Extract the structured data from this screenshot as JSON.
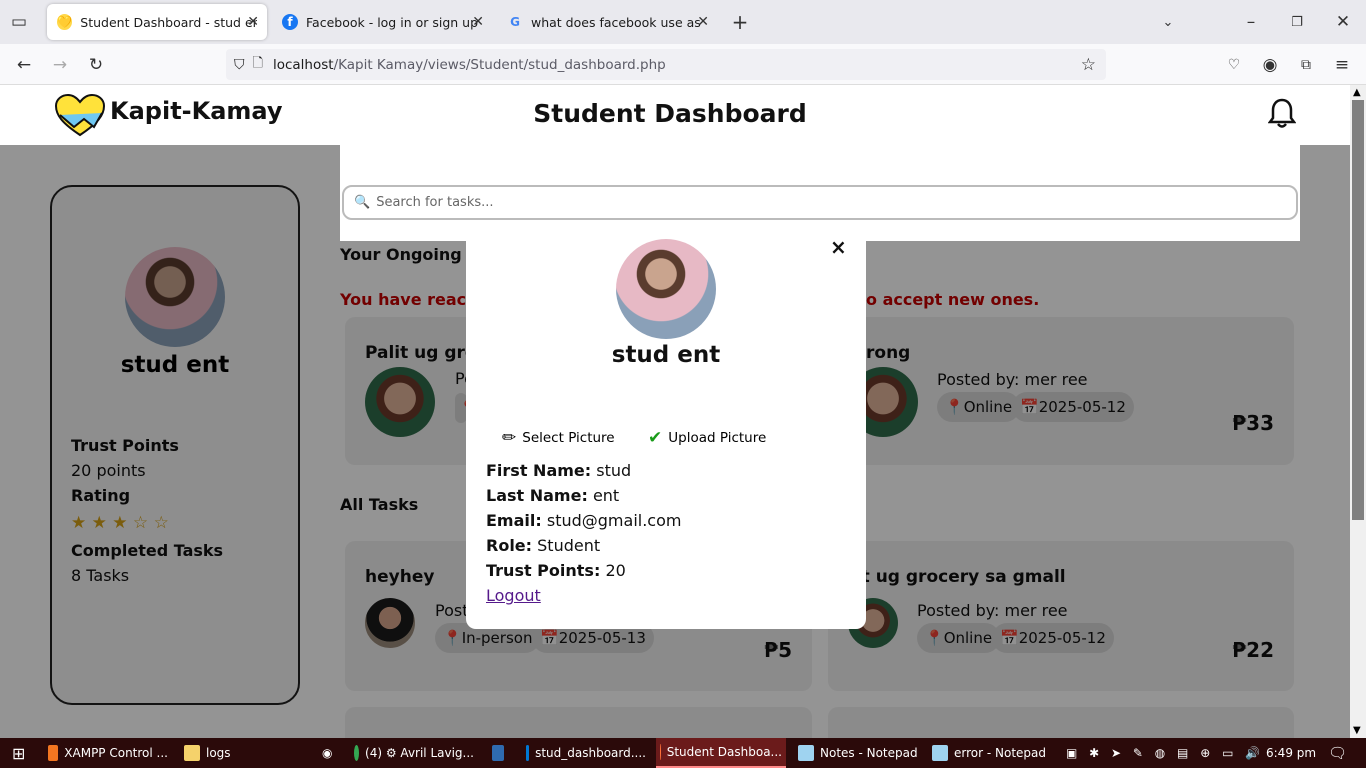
{
  "browser": {
    "tabs": [
      {
        "title": "Student Dashboard - stud ent",
        "active": true
      },
      {
        "title": "Facebook - log in or sign up",
        "active": false
      },
      {
        "title": "what does facebook use as a fo",
        "active": false
      }
    ],
    "url_host": "localhost",
    "url_path": "/Kapit Kamay/views/Student/stud_dashboard.php"
  },
  "header": {
    "logo_text": "Kapit-Kamay",
    "title": "Student Dashboard"
  },
  "profile": {
    "name": "stud ent",
    "trust_points_label": "Trust Points",
    "trust_points_value": "20 points",
    "rating_label": "Rating",
    "rating_stars": "★ ★ ★ ☆ ☆",
    "rating_value": 3,
    "completed_label": "Completed Tasks",
    "completed_value": "8 Tasks"
  },
  "search": {
    "placeholder": "Search for tasks..."
  },
  "ongoing": {
    "heading": "Your Ongoing T",
    "limit_warning_left": "You have reach",
    "limit_warning_right": "o accept new ones.",
    "tasks": [
      {
        "title": "Palit ug gro",
        "posted": "Po",
        "price": ""
      },
      {
        "title": "rong",
        "posted": "Posted by: mer ree",
        "mode": "Online",
        "date": "2025-05-12",
        "price": "₱33"
      }
    ]
  },
  "all_tasks": {
    "heading": "All Tasks",
    "tasks": [
      {
        "title": "heyhey",
        "posted": "Post",
        "mode": "In-person",
        "date": "2025-05-13",
        "price": "₱5"
      },
      {
        "title": "lit ug grocery sa gmall",
        "posted": "Posted by: mer ree",
        "mode": "Online",
        "date": "2025-05-12",
        "price": "₱22"
      }
    ]
  },
  "modal": {
    "name": "stud ent",
    "select_picture": "Select Picture",
    "upload_picture": "Upload Picture",
    "first_name_label": "First Name:",
    "first_name": "stud",
    "last_name_label": "Last Name:",
    "last_name": "ent",
    "email_label": "Email:",
    "email": "stud@gmail.com",
    "role_label": "Role:",
    "role": "Student",
    "trust_label": "Trust Points:",
    "trust": "20",
    "logout": "Logout",
    "close": "×"
  },
  "taskbar": {
    "items": [
      "XAMPP Control ...",
      "logs",
      "(4) ⚙ Avril Lavig...",
      "stud_dashboard....",
      "Student Dashboa...",
      "Notes - Notepad",
      "error - Notepad"
    ],
    "time": "6:49 pm"
  },
  "colors": {
    "warning": "#c40000",
    "taskbar": "#2b0a0a",
    "star": "#d4a017"
  }
}
